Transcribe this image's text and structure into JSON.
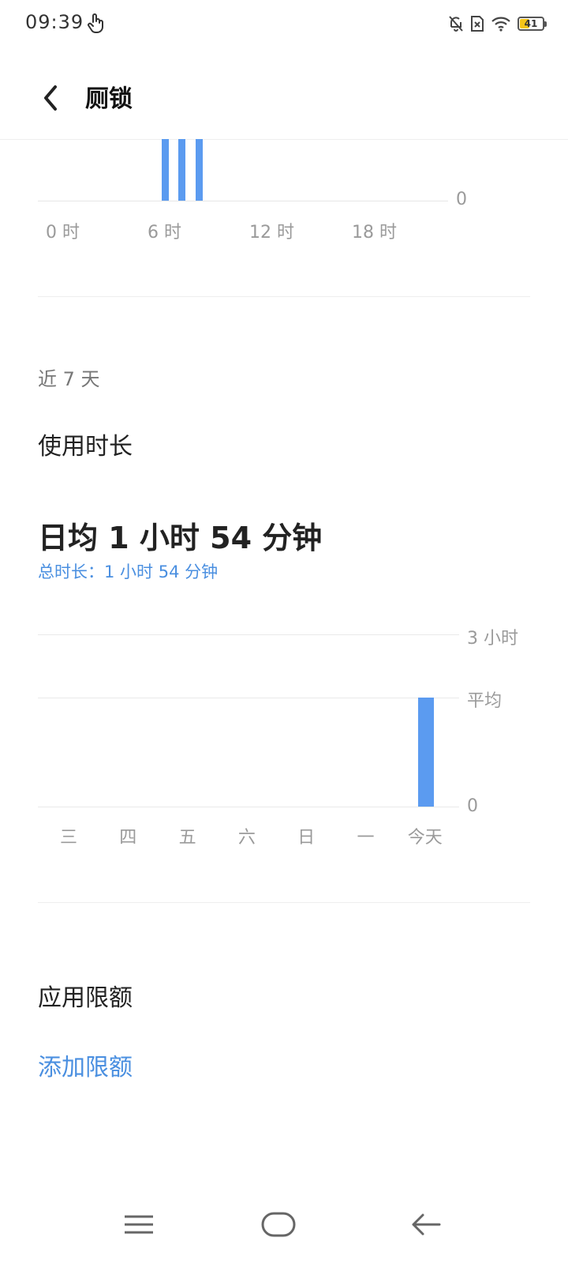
{
  "status_bar": {
    "time": "09:39",
    "battery_level": "41",
    "icons": [
      "touch-icon",
      "mute-bell-icon",
      "no-sim-icon",
      "wifi-icon",
      "battery-icon"
    ]
  },
  "header": {
    "title": "厕锁"
  },
  "hourly_chart": {
    "zero_label": "0",
    "x_labels": [
      "0 时",
      "6 时",
      "12 时",
      "18 时"
    ]
  },
  "weekly": {
    "range_label": "近 7 天",
    "section_title": "使用时长",
    "daily_avg": "日均 1 小时 54 分钟",
    "total": "总时长：1 小时 54 分钟"
  },
  "chart_data": {
    "type": "bar",
    "categories": [
      "三",
      "四",
      "五",
      "六",
      "日",
      "一",
      "今天"
    ],
    "values": [
      0,
      0,
      0,
      0,
      0,
      0,
      114
    ],
    "ylim": [
      0,
      180
    ],
    "y_tick_labels": [
      "3 小时",
      "平均",
      "0"
    ],
    "average_value": 114,
    "bar_color": "#5b9bf0"
  },
  "limits": {
    "section_title": "应用限额",
    "add_link": "添加限额"
  },
  "colors": {
    "accent": "#4a8fe0",
    "bar": "#5b9bf0"
  }
}
